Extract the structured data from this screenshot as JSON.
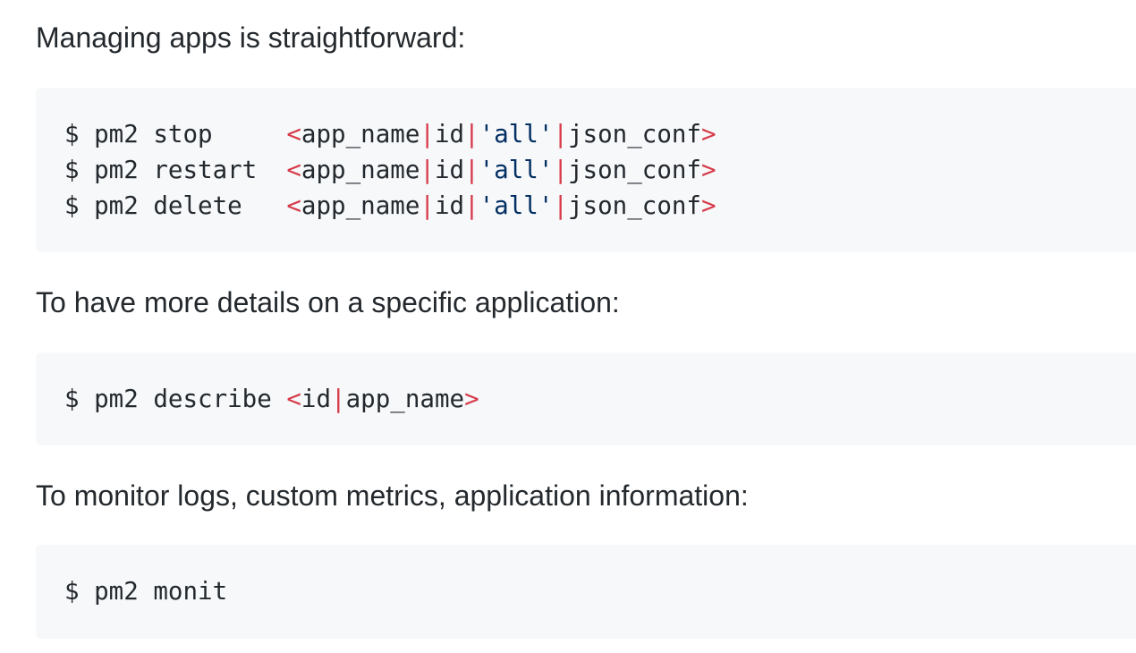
{
  "paragraphs": {
    "managing": "Managing apps is straightforward:",
    "details": "To have more details on a specific application:",
    "monitor": "To monitor logs, custom metrics, application information:"
  },
  "code_blocks": {
    "manage": {
      "lines": [
        {
          "prefix": "$ pm2 stop     ",
          "lt": "<",
          "name": "app_name",
          "pipe1": "|",
          "id": "id",
          "pipe2": "|",
          "all": "'all'",
          "pipe3": "|",
          "conf": "json_conf",
          "gt": ">"
        },
        {
          "prefix": "$ pm2 restart  ",
          "lt": "<",
          "name": "app_name",
          "pipe1": "|",
          "id": "id",
          "pipe2": "|",
          "all": "'all'",
          "pipe3": "|",
          "conf": "json_conf",
          "gt": ">"
        },
        {
          "prefix": "$ pm2 delete   ",
          "lt": "<",
          "name": "app_name",
          "pipe1": "|",
          "id": "id",
          "pipe2": "|",
          "all": "'all'",
          "pipe3": "|",
          "conf": "json_conf",
          "gt": ">"
        }
      ]
    },
    "describe": {
      "prefix": "$ pm2 describe ",
      "lt": "<",
      "id": "id",
      "pipe": "|",
      "name": "app_name",
      "gt": ">"
    },
    "monit": {
      "text": "$ pm2 monit"
    }
  },
  "colors": {
    "text": "#24292e",
    "code_background": "#f6f8fa",
    "punctuation": "#d73a49",
    "string": "#032f62"
  }
}
